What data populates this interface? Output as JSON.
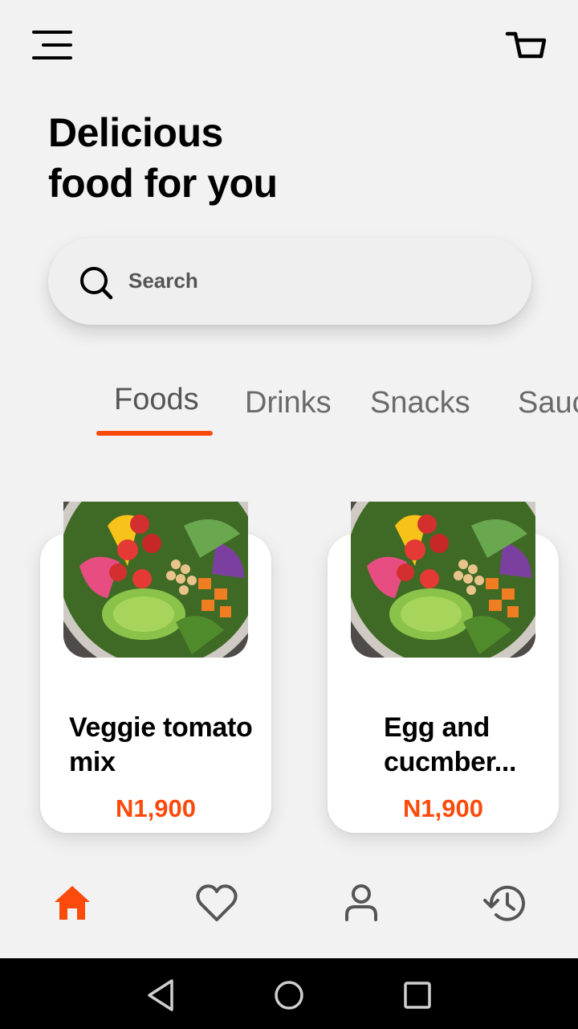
{
  "header": {
    "menu_icon": "hamburger-menu-icon",
    "cart_icon": "shopping-cart-icon"
  },
  "headline": {
    "line1": "Delicious",
    "line2": "food for you"
  },
  "search": {
    "placeholder": "Search",
    "icon": "search-icon"
  },
  "tabs": [
    {
      "label": "Foods",
      "active": true
    },
    {
      "label": "Drinks",
      "active": false
    },
    {
      "label": "Snacks",
      "active": false
    },
    {
      "label": "Sauce",
      "active": false
    }
  ],
  "products": [
    {
      "name_line1": "Veggie tomato",
      "name_line2": "mix",
      "price": "N1,900"
    },
    {
      "name_line1": "Egg and",
      "name_line2": "cucmber...",
      "price": "N1,900"
    }
  ],
  "bottom_nav": [
    {
      "icon": "home-icon",
      "active": true
    },
    {
      "icon": "heart-icon",
      "active": false
    },
    {
      "icon": "user-icon",
      "active": false
    },
    {
      "icon": "history-icon",
      "active": false
    }
  ],
  "system_nav": [
    "back-icon",
    "home-circle-icon",
    "recents-icon"
  ],
  "colors": {
    "accent": "#fa4a0c",
    "background": "#f2f2f2",
    "card": "#ffffff",
    "text": "#000000"
  }
}
